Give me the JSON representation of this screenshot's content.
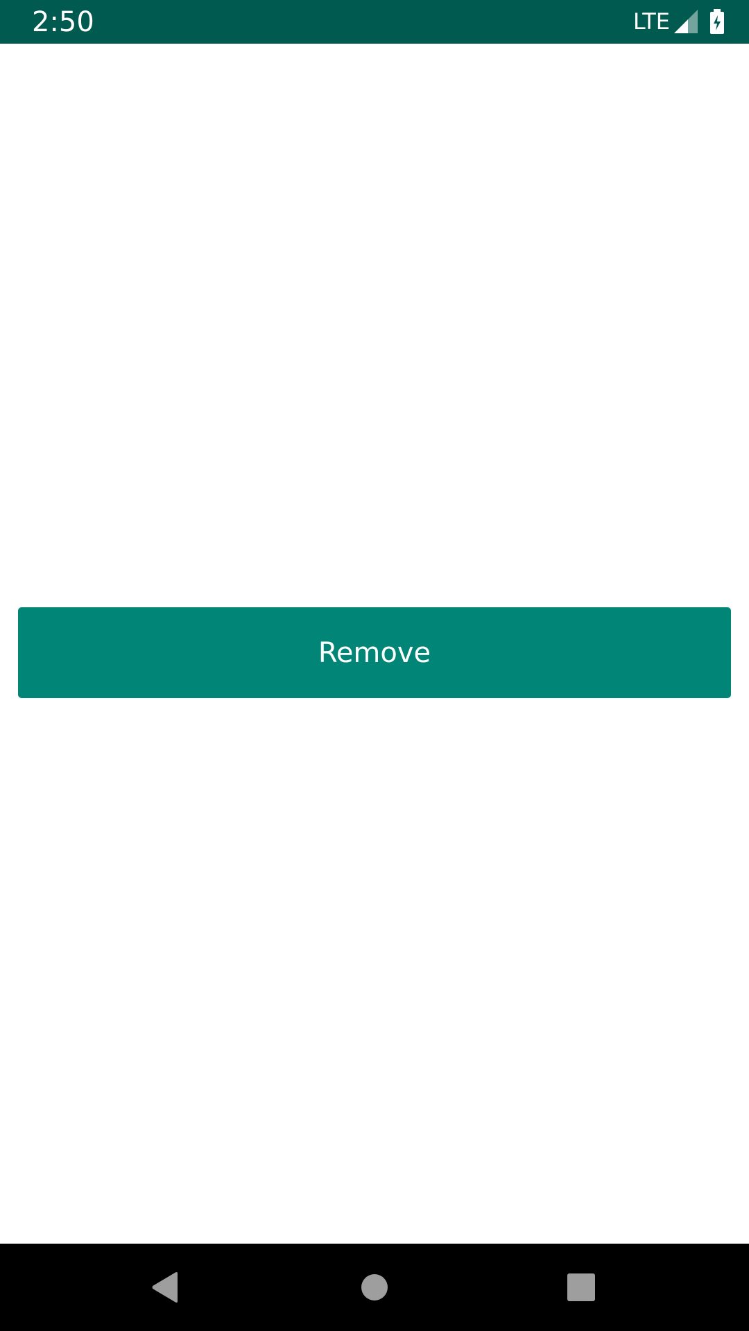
{
  "status_bar": {
    "time": "2:50",
    "network_label": "LTE",
    "icons": [
      "signal-icon",
      "battery-charging-icon"
    ]
  },
  "main": {
    "remove_button_label": "Remove"
  },
  "nav_bar": {
    "icons": [
      "back-icon",
      "home-icon",
      "recents-icon"
    ]
  },
  "colors": {
    "status_bar": "#005a4f",
    "button": "#008577",
    "nav_bar": "#000000",
    "nav_icon": "#9e9e9e"
  }
}
